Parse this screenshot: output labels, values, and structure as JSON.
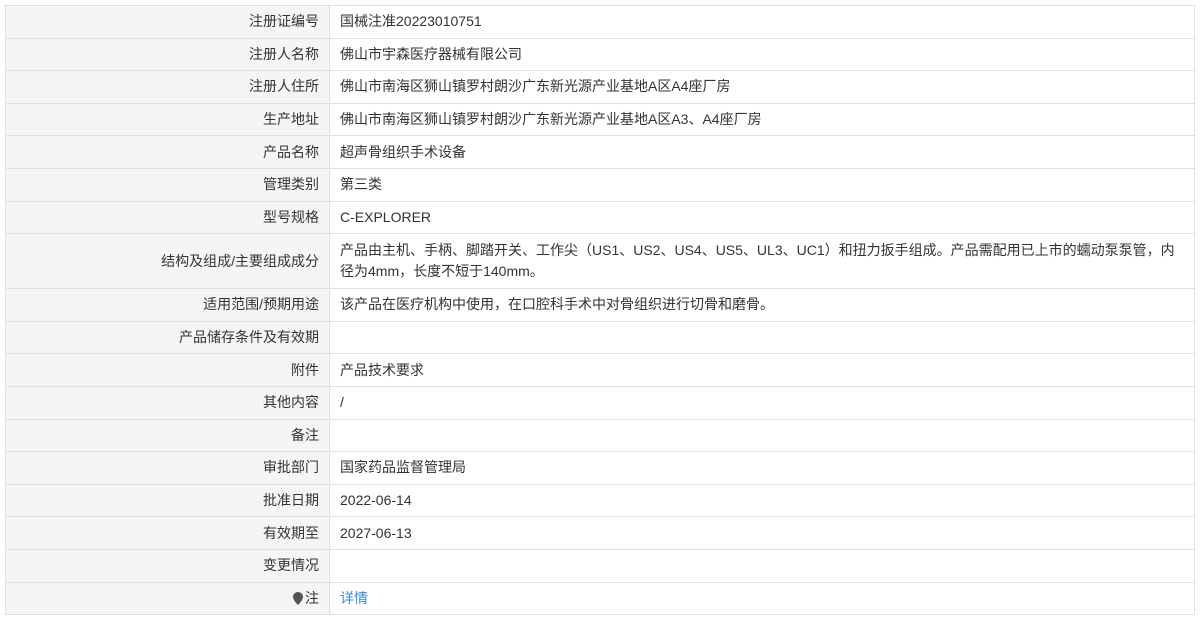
{
  "rows": [
    {
      "label": "注册证编号",
      "value": "国械注准20223010751"
    },
    {
      "label": "注册人名称",
      "value": "佛山市宇森医疗器械有限公司"
    },
    {
      "label": "注册人住所",
      "value": "佛山市南海区狮山镇罗村朗沙广东新光源产业基地A区A4座厂房"
    },
    {
      "label": "生产地址",
      "value": "佛山市南海区狮山镇罗村朗沙广东新光源产业基地A区A3、A4座厂房"
    },
    {
      "label": "产品名称",
      "value": "超声骨组织手术设备"
    },
    {
      "label": "管理类别",
      "value": "第三类"
    },
    {
      "label": "型号规格",
      "value": "C-EXPLORER"
    },
    {
      "label": "结构及组成/主要组成成分",
      "value": "产品由主机、手柄、脚踏开关、工作尖（US1、US2、US4、US5、UL3、UC1）和扭力扳手组成。产品需配用已上市的蠕动泵泵管，内径为4mm，长度不短于140mm。"
    },
    {
      "label": "适用范围/预期用途",
      "value": "该产品在医疗机构中使用，在口腔科手术中对骨组织进行切骨和磨骨。"
    },
    {
      "label": "产品储存条件及有效期",
      "value": ""
    },
    {
      "label": "附件",
      "value": "产品技术要求"
    },
    {
      "label": "其他内容",
      "value": "/"
    },
    {
      "label": "备注",
      "value": ""
    },
    {
      "label": "审批部门",
      "value": "国家药品监督管理局"
    },
    {
      "label": "批准日期",
      "value": "2022-06-14"
    },
    {
      "label": "有效期至",
      "value": "2027-06-13"
    },
    {
      "label": "变更情况",
      "value": ""
    }
  ],
  "note": {
    "icon": "map-pin-icon",
    "label": "注",
    "link_text": "详情"
  },
  "colors": {
    "label_background": "#f5f5f5",
    "value_background": "#ffffff",
    "border": "#e0e0e0",
    "text": "#333333",
    "link": "#3a87d8",
    "icon": "#555555"
  }
}
